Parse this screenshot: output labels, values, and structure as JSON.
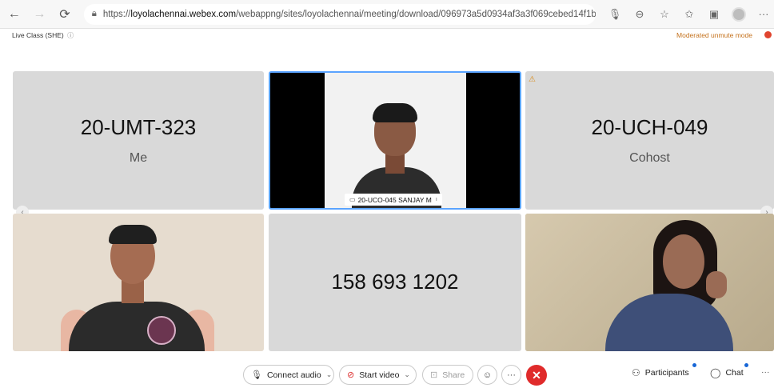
{
  "browser": {
    "url_prefix": "https://",
    "url_host": "loyolachennai.webex.com",
    "url_path": "/webappng/sites/loyolachennai/meeting/download/096973a5d0934af3a3f069cebed14f1b?siteurl=loyolac..."
  },
  "meeting": {
    "title": "Live Class (SHE)",
    "unmute_mode": "Moderated unmute mode"
  },
  "tiles": [
    {
      "name": "20-UMT-323",
      "role": "Me"
    },
    {
      "name": "20-UCO-045 SANJAY M"
    },
    {
      "name": "20-UCH-049",
      "role": "Cohost"
    },
    {
      "name": "158 693 1202"
    }
  ],
  "toolbar": {
    "connect_audio": "Connect audio",
    "start_video": "Start video",
    "share": "Share",
    "participants": "Participants",
    "chat": "Chat"
  },
  "colors": {
    "accent": "#1766d6",
    "end_call": "#e02b2b",
    "unmute_mode": "#c4711c",
    "active_border": "#5aa3ff"
  },
  "icons": [
    "back-icon",
    "forward-icon",
    "reload-icon",
    "lock-icon",
    "mic-icon",
    "zoom-icon",
    "favorite-icon",
    "collections-icon",
    "extensions-icon",
    "profile-icon",
    "more-icon",
    "info-icon",
    "warning-icon",
    "video-off-icon",
    "share-icon",
    "reaction-icon",
    "end-call-icon",
    "participants-icon",
    "chat-icon"
  ]
}
